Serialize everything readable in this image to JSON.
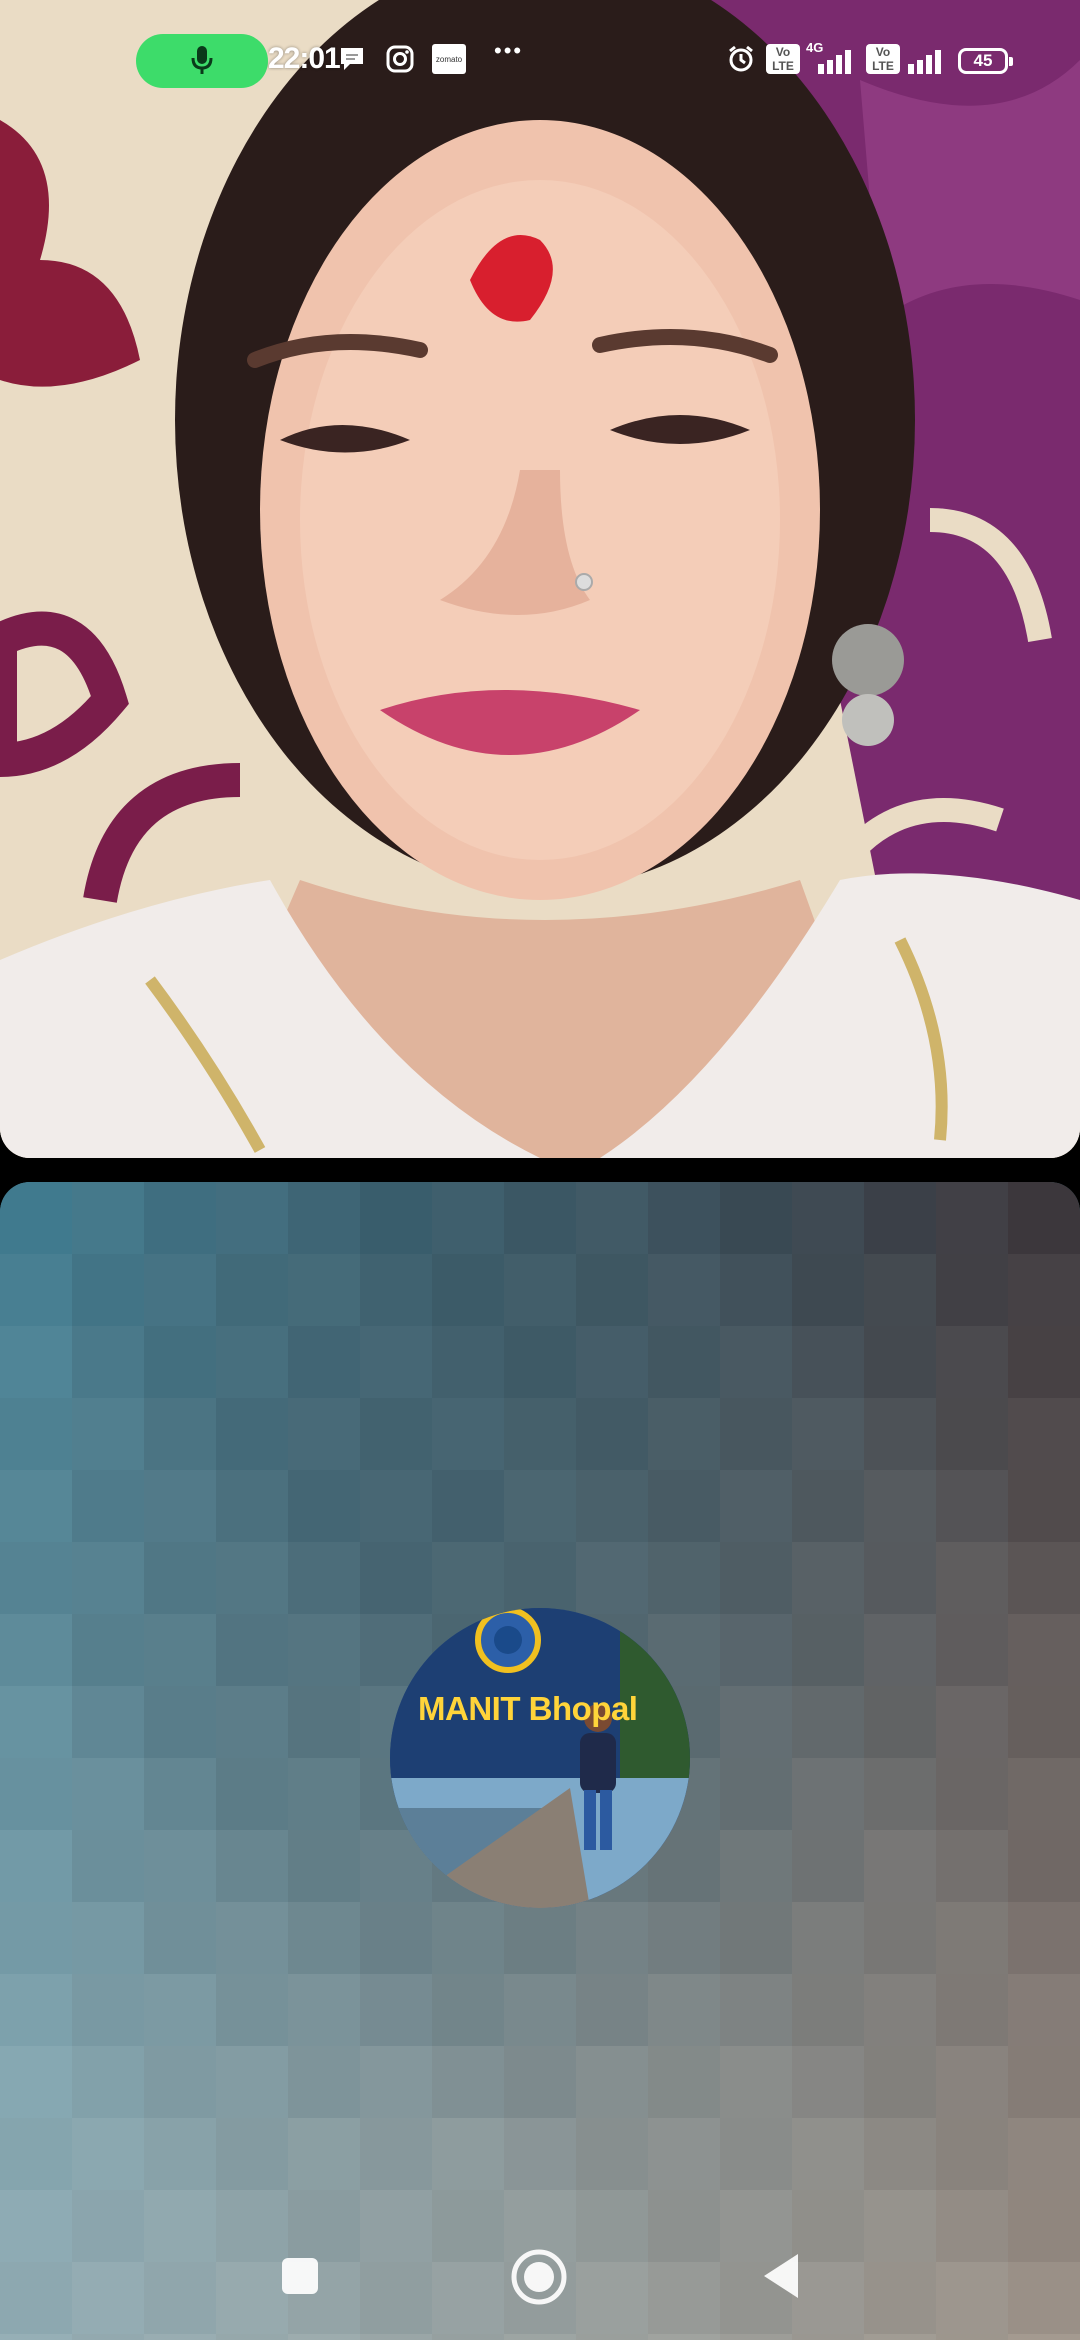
{
  "status_bar": {
    "time": "22:01",
    "app_icons": [
      "chat-bubble-icon",
      "instagram-icon",
      "zomato-icon"
    ],
    "zomato_label": "zomato",
    "overflow": "•••",
    "sim1_badge": "Vo LTE",
    "sim1_net": "4G",
    "sim2_badge": "Vo LTE",
    "battery_level": "45",
    "mic_active_color": "#3ddc6a"
  },
  "call": {
    "avatar_caption": "MANIT Bhopal"
  },
  "nav_bar": {
    "buttons": [
      "recents-square-icon",
      "home-circle-icon",
      "back-triangle-icon"
    ]
  }
}
